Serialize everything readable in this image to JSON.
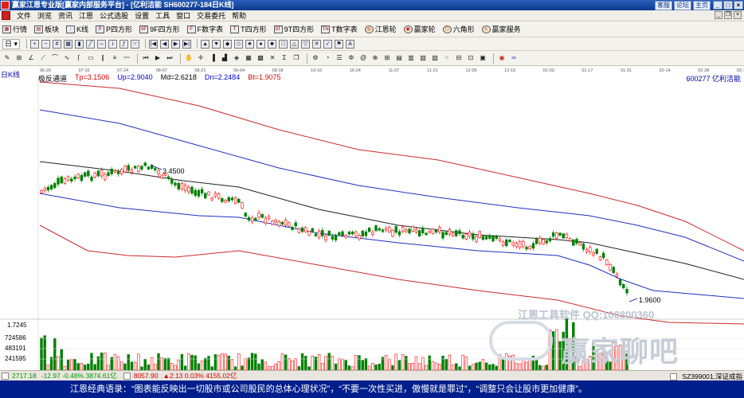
{
  "window": {
    "title": "赢家江恩专业版[赢家内部服务平台] - [亿利洁能  SH600277-184日K线]",
    "top_links": [
      "客服",
      "论坛",
      "主页"
    ],
    "controls": [
      "_",
      "□",
      "×"
    ]
  },
  "menu": {
    "items": [
      "文件",
      "浏览",
      "资讯",
      "江恩",
      "公式选股",
      "设置",
      "工具",
      "窗口",
      "交易委托",
      "帮助"
    ]
  },
  "toolbar1": {
    "items": [
      "行情",
      "板块",
      "K线",
      "P四方形",
      "9F四方形",
      "F数字表",
      "T四方形",
      "9T四方形",
      "T数字表",
      "江恩轮",
      "赢家轮",
      "六角形",
      "赢家服务"
    ]
  },
  "toolbar2": {
    "dropdown": "日 ▾"
  },
  "chart": {
    "period_label": "日K线",
    "indicator": {
      "name": "极反通道",
      "tp": "Tp=3.1506",
      "up": "Up=2.9040",
      "md": "Md=2.6218",
      "dn": "Dn=2.2484",
      "bt": "Bt=1.9075"
    },
    "stock_id": "600277 亿利洁能",
    "date_ticks": [
      "06-26",
      "07-10",
      "07-24",
      "08-07",
      "08-21",
      "09-04",
      "09-18",
      "10-10",
      "10-24",
      "11-07",
      "11-21",
      "12-05",
      "12-19",
      "01-03",
      "01-17",
      "01-31",
      "02-14",
      "02-28",
      "03-13"
    ],
    "annotations": {
      "high": "3.4500",
      "low": "1.9600"
    },
    "volume_labels": [
      "1.7245",
      "724586",
      "483191",
      "241595"
    ],
    "colors": {
      "up": "#ff0000",
      "down": "#008000",
      "tp_bt": "#cc2a2a",
      "up_dn": "#2030c0",
      "md": "#202020"
    },
    "watermark_tool": "江恩工具软件  QQ:100800360",
    "watermark_brand": "赢家聊吧"
  },
  "status": {
    "sh_index": "2717.18",
    "sh_change": "-12.97 -0.48% 3874.61亿",
    "sz_index": "8057.90",
    "sz_change": "▲2.13 0.03% 4155.02亿",
    "right_text": "SZ399001,深证成指"
  },
  "quote": {
    "text": "江恩经典语录：“图表能反映出一切股市或公司股民的总体心理状况”，“不要一次性买进，傲慢就是罪过”，“调整只会让股市更加健康”。"
  }
}
